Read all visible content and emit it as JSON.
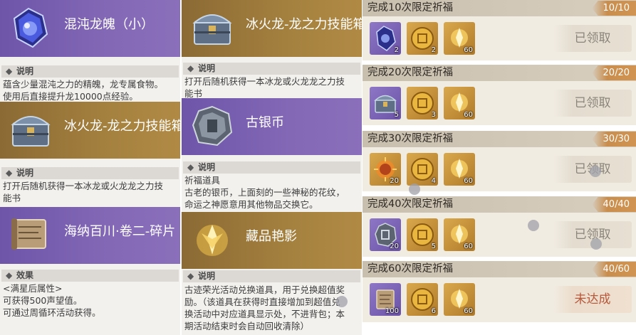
{
  "cards": [
    {
      "title": "混沌龙魄（小）",
      "section": "说明",
      "lines": [
        "蕴含少量混沌之力的精魄，龙专属食物。",
        "使用后直接提升龙10000点经验。"
      ]
    },
    {
      "title": "冰火龙-龙之力技能箱",
      "section": "说明",
      "lines": [
        "打开后随机获得一本冰龙或火龙龙之力技",
        "能书"
      ]
    },
    {
      "title": "冰火龙-龙之力技能箱",
      "section": "说明",
      "lines": [
        "打开后随机获得一本冰龙或火龙龙之力技",
        "能书"
      ]
    },
    {
      "title": "古银币",
      "section": "说明",
      "lines": [
        "祈福道具",
        "古老的银币，上面刻的一些神秘的花纹，",
        "命运之神愿意用其他物品交换它。"
      ]
    },
    {
      "title": "海纳百川·卷二-碎片",
      "section": "效果",
      "lines": [
        "<满星后属性>",
        "可获得500声望值。",
        "可通过周循环活动获得。"
      ]
    },
    {
      "title": "藏品艳影",
      "section": "说明",
      "lines": [
        "古迹荣光活动兑换道具，用于兑换超值奖",
        "励。（该道具在获得时直接增加到超值兑",
        "换活动中对应道具显示处，不进背包；本",
        "期活动结束时会自动回收清除）"
      ]
    }
  ],
  "rows": [
    {
      "title": "完成10次限定祈福",
      "count": "10/10",
      "status": "已领取",
      "claimed": true,
      "rewards": [
        {
          "icon": "dragon-soul-icon",
          "qty": "2"
        },
        {
          "icon": "gold-coin-icon",
          "qty": "2"
        },
        {
          "icon": "radiant-shard-icon",
          "qty": "60"
        }
      ]
    },
    {
      "title": "完成20次限定祈福",
      "count": "20/20",
      "status": "已领取",
      "claimed": true,
      "rewards": [
        {
          "icon": "skill-chest-icon",
          "qty": "5"
        },
        {
          "icon": "gold-coin-icon",
          "qty": "3"
        },
        {
          "icon": "radiant-shard-icon",
          "qty": "60"
        }
      ]
    },
    {
      "title": "完成30次限定祈福",
      "count": "30/30",
      "status": "已领取",
      "claimed": true,
      "rewards": [
        {
          "icon": "sun-emblem-icon",
          "qty": "20"
        },
        {
          "icon": "gold-coin-icon",
          "qty": "4"
        },
        {
          "icon": "radiant-shard-icon",
          "qty": "60"
        }
      ]
    },
    {
      "title": "完成40次限定祈福",
      "count": "40/40",
      "status": "已领取",
      "claimed": true,
      "rewards": [
        {
          "icon": "silver-coin-icon",
          "qty": "20"
        },
        {
          "icon": "gold-coin-icon",
          "qty": "5"
        },
        {
          "icon": "radiant-shard-icon",
          "qty": "60"
        }
      ]
    },
    {
      "title": "完成60次限定祈福",
      "count": "40/60",
      "status": "未达成",
      "claimed": false,
      "rewards": [
        {
          "icon": "scroll-fragment-icon",
          "qty": "100"
        },
        {
          "icon": "gold-coin-icon",
          "qty": "6"
        },
        {
          "icon": "radiant-shard-icon",
          "qty": "60"
        }
      ]
    }
  ],
  "colors": {
    "purple_header": "#7a5fb0",
    "gold_header": "#a5813f",
    "count_badge": "#c98d4d",
    "pending_text": "#b5583c"
  }
}
